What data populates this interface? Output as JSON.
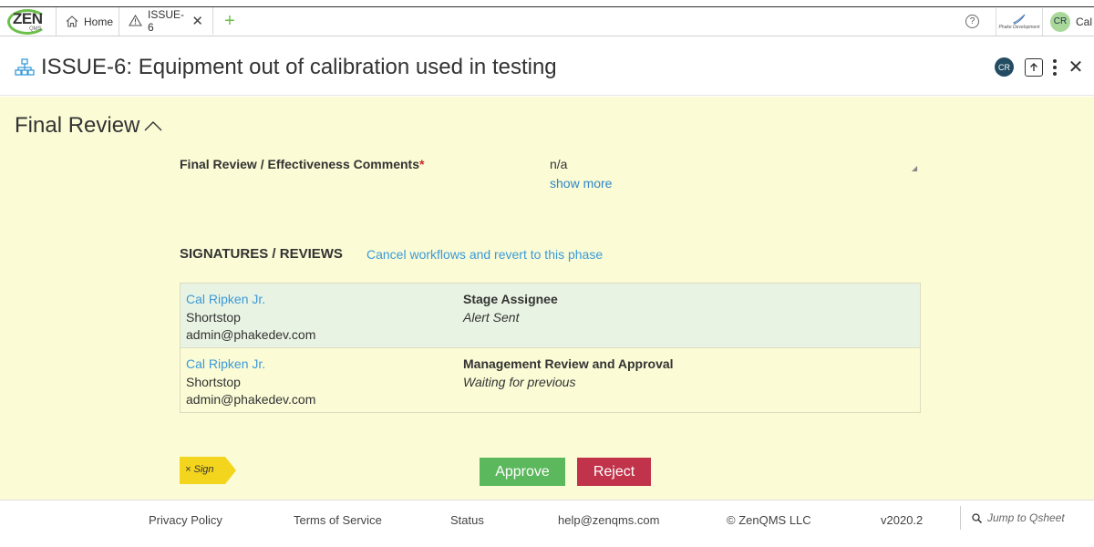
{
  "app": {
    "logo_text": "ZEN",
    "logo_sub": "QMS",
    "tabs": [
      {
        "label": "Home",
        "icon": "home-icon"
      },
      {
        "label": "ISSUE-6",
        "icon": "warning-icon"
      }
    ],
    "add_tab": "+",
    "help": "?",
    "brand_small": "Phake Development",
    "user_initials": "CR",
    "user_name": "Cal Ripken Jr."
  },
  "header": {
    "title": "ISSUE-6: Equipment out of calibration used in testing",
    "avatar_initials": "CR",
    "icons": [
      "hierarchy-icon",
      "upload-icon",
      "more-vertical-icon",
      "close-icon"
    ]
  },
  "section": {
    "title": "Final Review",
    "field": {
      "label": "Final Review / Effectiveness Comments",
      "required_mark": "*",
      "value": "n/a",
      "show_more": "show more"
    },
    "signatures": {
      "title": "SIGNATURES / REVIEWS",
      "cancel_link": "Cancel workflows and revert to this phase",
      "rows": [
        {
          "name": "Cal Ripken Jr.",
          "position": "Shortstop",
          "email": "admin@phakedev.com",
          "stage": "Stage Assignee",
          "status": "Alert Sent"
        },
        {
          "name": "Cal Ripken Jr.",
          "position": "Shortstop",
          "email": "admin@phakedev.com",
          "stage": "Management Review and Approval",
          "status": "Waiting for previous"
        }
      ]
    },
    "actions": {
      "sign_label": "× Sign",
      "approve": "Approve",
      "reject": "Reject"
    }
  },
  "footer": {
    "privacy": "Privacy Policy",
    "terms": "Terms of Service",
    "status": "Status",
    "help_email": "help@zenqms.com",
    "copyright": "© ZenQMS LLC",
    "version": "v2020.2",
    "jump_placeholder": "Jump to Qsheet"
  },
  "colors": {
    "accent_green": "#6cc04a",
    "approve": "#5cb85c",
    "reject": "#c0334b",
    "link": "#3a9ad9",
    "panel_bg": "#fbfbd6",
    "sign_tag": "#f3d51d"
  }
}
